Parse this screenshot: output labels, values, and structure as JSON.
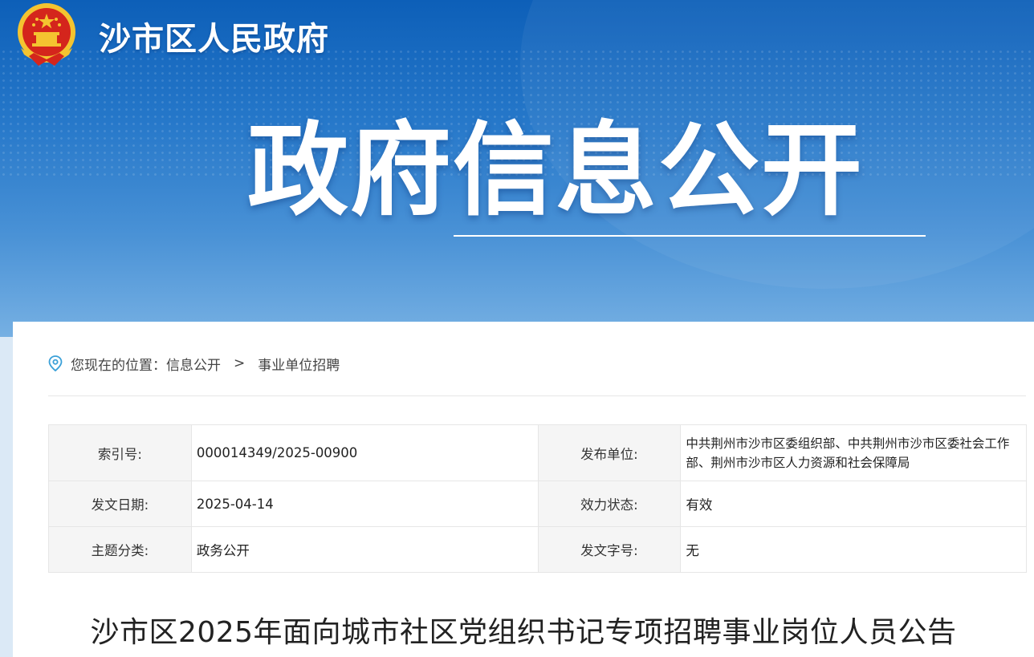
{
  "header": {
    "site_name": "沙市区人民政府",
    "section_title": "政府信息公开"
  },
  "breadcrumb": {
    "prefix": "您现在的位置：",
    "items": [
      {
        "label": "信息公开"
      },
      {
        "label": "事业单位招聘"
      }
    ],
    "separator": ">"
  },
  "meta": {
    "rows": [
      {
        "label1": "索引号:",
        "value1": "000014349/2025-00900",
        "label2": "发布单位:",
        "value2": "中共荆州市沙市区委组织部、中共荆州市沙市区委社会工作部、荆州市沙市区人力资源和社会保障局"
      },
      {
        "label1": "发文日期:",
        "value1": "2025-04-14",
        "label2": "效力状态:",
        "value2": "有效"
      },
      {
        "label1": "主题分类:",
        "value1": "政务公开",
        "label2": "发文字号:",
        "value2": "无"
      }
    ]
  },
  "article": {
    "title": "沙市区2025年面向城市社区党组织书记专项招聘事业岗位人员公告"
  },
  "icons": {
    "emblem": "national-emblem-icon",
    "location": "location-pin-icon"
  },
  "colors": {
    "banner_top": "#0d5fb8",
    "banner_bottom": "#76b0e3",
    "emblem_red": "#d4251c",
    "emblem_gold": "#f4c430",
    "location_icon": "#3aa0d8"
  }
}
